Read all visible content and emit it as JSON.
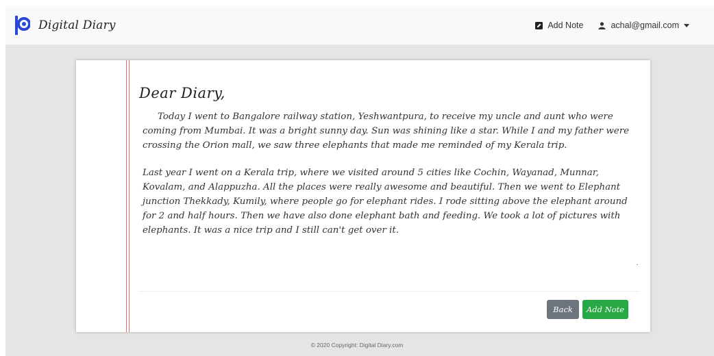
{
  "navbar": {
    "brand": "Digital Diary",
    "logo_icon": "pd-logo-icon",
    "add_note_label": "Add Note",
    "add_note_icon": "edit-square-icon",
    "user_email": "achal@gmail.com",
    "user_icon": "user-icon",
    "colors": {
      "logo": "#2b47d6",
      "navbar_bg": "#f8f9fa"
    }
  },
  "note": {
    "greeting": "Dear Diary,",
    "paragraph1": "Today I went to Bangalore railway station, Yeshwantpura, to receive my uncle and aunt who were coming from Mumbai. It was a bright sunny day. Sun was shining like a star. While I and my father were crossing the Orion mall, we saw three elephants that made me reminded of my Kerala trip.",
    "paragraph2": "Last year I went on a Kerala trip, where we visited around 5 cities like Cochin, Wayanad, Munnar, Kovalam, and Alappuzha. All the places were really awesome and beautiful. Then we went to Elephant junction Thekkady, Kumily, where people go for elephant rides. I rode sitting above the elephant around for 2 and half hours. Then we have also done elephant bath and feeding. We took a lot of pictures with elephants. It was a nice trip and I still can't get over it."
  },
  "actions": {
    "back_label": "Back",
    "add_note_label": "Add Note",
    "colors": {
      "back": "#6c757d",
      "add": "#28a745"
    }
  },
  "footer": {
    "copyright": "© 2020 Copyright: Digital Diary.com"
  }
}
